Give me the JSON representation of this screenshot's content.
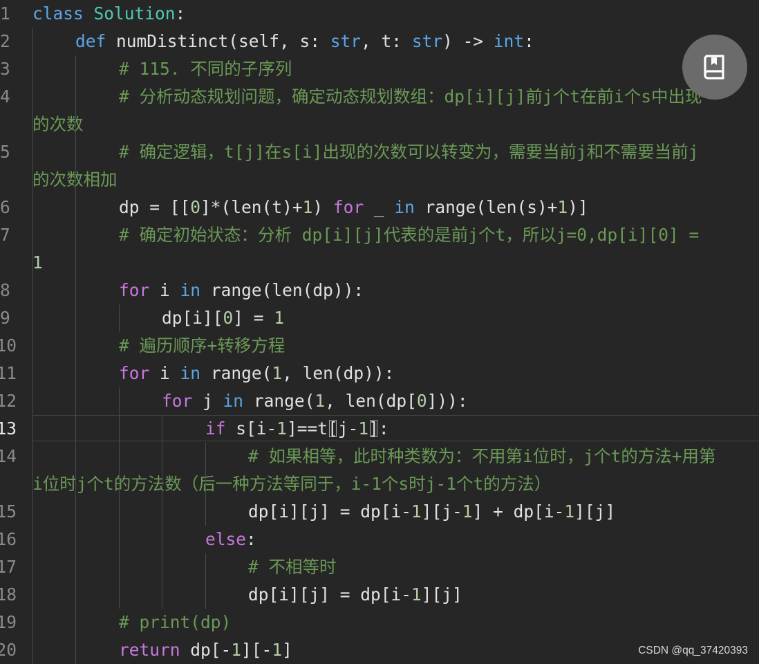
{
  "colors": {
    "background": "#262626",
    "keyword_blue": "#5aa6e6",
    "keyword_purple": "#c678dd",
    "class_name": "#4ec9b0",
    "comment": "#6a9955",
    "number": "#b5cea8",
    "text": "#e1e1e1",
    "fab": "#6b6b6b"
  },
  "lines": [
    {
      "no": "1",
      "text": "class Solution:"
    },
    {
      "no": "2",
      "text": "def numDistinct(self, s: str, t: str) -> int:"
    },
    {
      "no": "3",
      "text": "# 115. 不同的子序列"
    },
    {
      "no": "4",
      "text": "# 分析动态规划问题，确定动态规划数组：dp[i][j]前j个t在前i个s中出现",
      "wrap": "的次数"
    },
    {
      "no": "5",
      "text": "# 确定逻辑，t[j]在s[i]出现的次数可以转变为，需要当前j和不需要当前j",
      "wrap": "的次数相加"
    },
    {
      "no": "6",
      "text": "dp = [[0]*(len(t)+1) for _ in range(len(s)+1)]"
    },
    {
      "no": "7",
      "text": "# 确定初始状态：分析 dp[i][j]代表的是前j个t，所以j=0,dp[i][0] =",
      "wrap": "1"
    },
    {
      "no": "8",
      "text": "for i in range(len(dp)):"
    },
    {
      "no": "9",
      "text": "dp[i][0] = 1"
    },
    {
      "no": "10",
      "text": "# 遍历顺序+转移方程"
    },
    {
      "no": "11",
      "text": "for i in range(1, len(dp)):"
    },
    {
      "no": "12",
      "text": "for j in range(1, len(dp[0])):"
    },
    {
      "no": "13",
      "text": "if s[i-1]==t[j-1]:"
    },
    {
      "no": "14",
      "text": "# 如果相等，此时种类数为：不用第i位时，j个t的方法+用第",
      "wrap": "i位时j个t的方法数（后一种方法等同于，i-1个s时j-1个t的方法）"
    },
    {
      "no": "15",
      "text": "dp[i][j] = dp[i-1][j-1] + dp[i-1][j]"
    },
    {
      "no": "16",
      "text": "else:"
    },
    {
      "no": "17",
      "text": "# 不相等时"
    },
    {
      "no": "18",
      "text": "dp[i][j] = dp[i-1][j]"
    },
    {
      "no": "19",
      "text": "# print(dp)"
    },
    {
      "no": "20",
      "text": "return dp[-1][-1]"
    }
  ],
  "fab": {
    "icon": "bookmark-book-icon"
  },
  "watermark": "CSDN @qq_37420393"
}
